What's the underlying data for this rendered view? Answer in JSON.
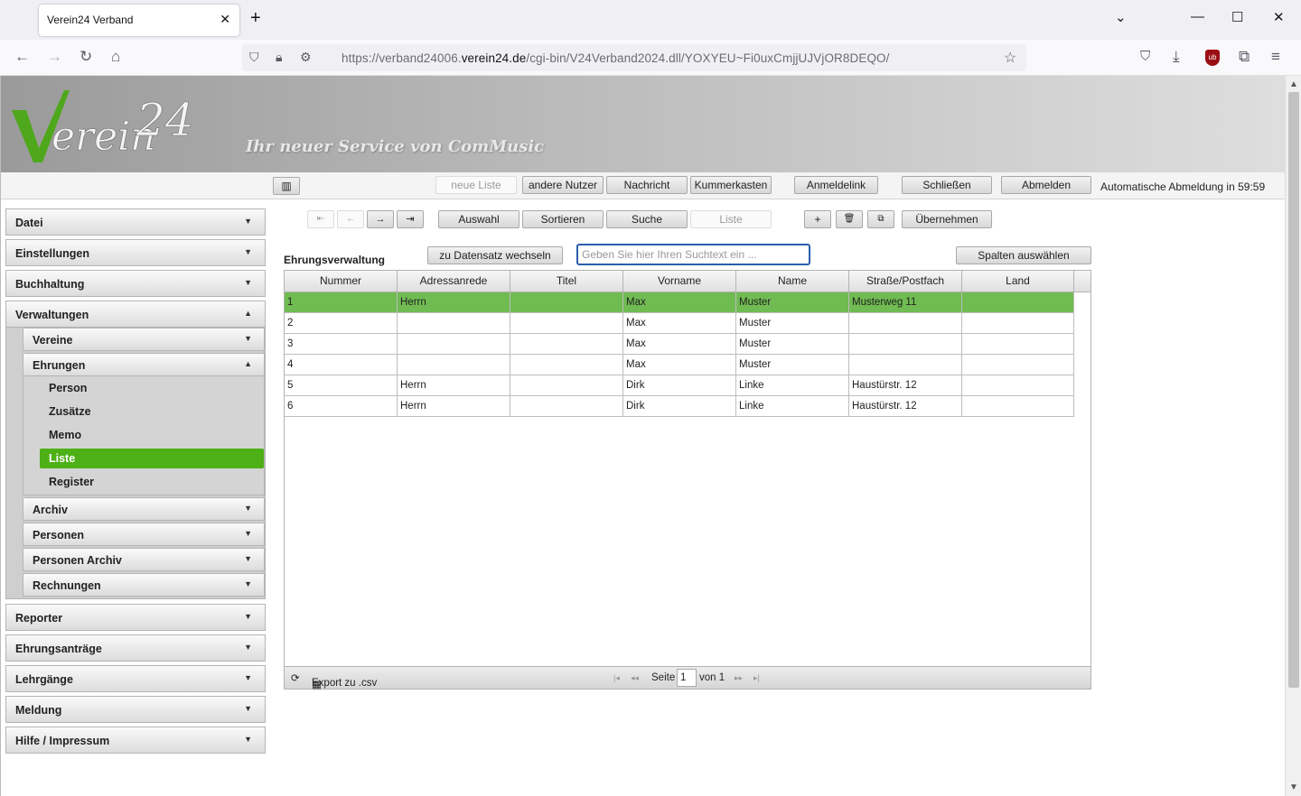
{
  "browser": {
    "tab_title": "Verein24 Verband",
    "url_prefix": "https://verband24006.",
    "url_domain": "verein24.de",
    "url_path": "/cgi-bin/V24Verband2024.dll/YOXYEU~Fi0uxCmjjUJVjOR8DEQO/"
  },
  "header": {
    "logo_text": "Verein 24",
    "slogan": "Ihr neuer Service von ComMusic"
  },
  "topbar": {
    "neue_liste": "neue Liste",
    "andere_nutzer": "andere Nutzer",
    "nachricht": "Nachricht",
    "kummerkasten": "Kummerkasten",
    "anmeldelink": "Anmeldelink",
    "schliessen": "Schließen",
    "abmelden": "Abmelden",
    "auto_logout": "Automatische Abmeldung in 59:59"
  },
  "sidebar": {
    "datei": "Datei",
    "einstellungen": "Einstellungen",
    "buchhaltung": "Buchhaltung",
    "verwaltungen": "Verwaltungen",
    "vereine": "Vereine",
    "ehrungen": "Ehrungen",
    "person": "Person",
    "zusaetze": "Zusätze",
    "memo": "Memo",
    "liste": "Liste",
    "register": "Register",
    "archiv": "Archiv",
    "personen": "Personen",
    "personen_archiv": "Personen Archiv",
    "rechnungen": "Rechnungen",
    "reporter": "Reporter",
    "ehrungsantraege": "Ehrungsanträge",
    "lehrgaenge": "Lehrgänge",
    "meldung": "Meldung",
    "hilfe": "Hilfe / Impressum"
  },
  "toolbar": {
    "auswahl": "Auswahl",
    "sortieren": "Sortieren",
    "suche": "Suche",
    "liste": "Liste",
    "uebernehmen": "Übernehmen",
    "zu_datensatz": "zu Datensatz wechseln",
    "search_placeholder": "Geben Sie hier Ihren Suchtext ein ...",
    "spalten": "Spalten auswählen"
  },
  "main": {
    "title": "Ehrungsverwaltung"
  },
  "table": {
    "columns": [
      "Nummer",
      "Adressanrede",
      "Titel",
      "Vorname",
      "Name",
      "Straße/Postfach",
      "Land"
    ],
    "rows": [
      [
        "1",
        "Herrn",
        "",
        "Max",
        "Muster",
        "Musterweg 11",
        ""
      ],
      [
        "2",
        "",
        "",
        "Max",
        "Muster",
        "",
        ""
      ],
      [
        "3",
        "",
        "",
        "Max",
        "Muster",
        "",
        ""
      ],
      [
        "4",
        "",
        "",
        "Max",
        "Muster",
        "",
        ""
      ],
      [
        "5",
        "Herrn",
        "",
        "Dirk",
        "Linke",
        "Haustürstr. 12",
        ""
      ],
      [
        "6",
        "Herrn",
        "",
        "Dirk",
        "Linke",
        "Haustürstr. 12",
        ""
      ]
    ],
    "selected_row": 0
  },
  "footer": {
    "export": "Export zu .csv",
    "seite": "Seite",
    "page": "1",
    "von": "von 1"
  },
  "colors": {
    "active_green": "#4db017",
    "selected_row": "#70bb52",
    "focus_blue": "#2b5fab"
  }
}
